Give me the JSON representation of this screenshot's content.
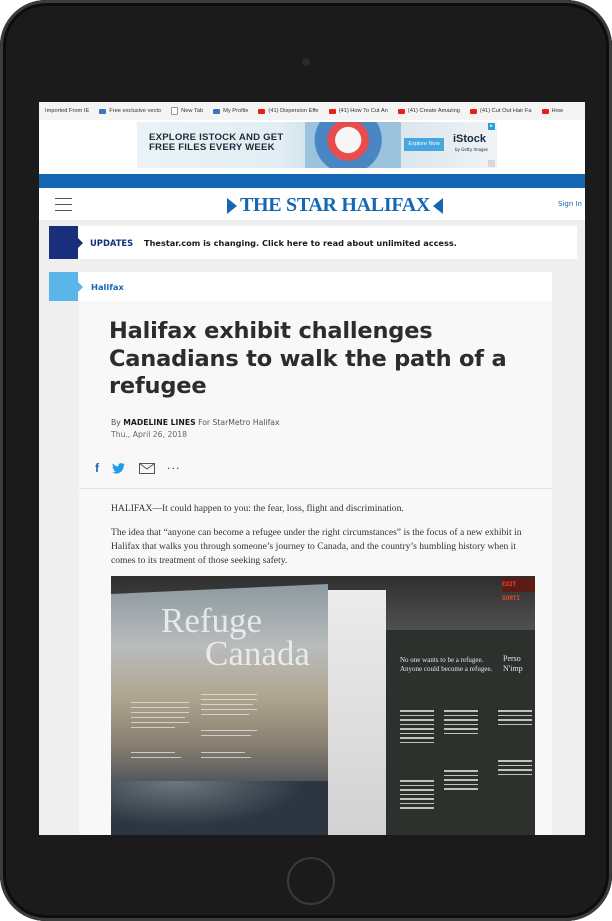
{
  "bookmarks": [
    {
      "label": "Imported From IE",
      "icon": "none"
    },
    {
      "label": "Free exclusive vecto",
      "icon": "image-icon",
      "color": "#3a77c2"
    },
    {
      "label": "New Tab",
      "icon": "page-icon",
      "color": "#ffffff"
    },
    {
      "label": "My Profile",
      "icon": "image-icon",
      "color": "#3a77c2"
    },
    {
      "label": "(41) Dispersion Effe",
      "icon": "youtube-icon",
      "color": "#e62117"
    },
    {
      "label": "(41) How To Cut An",
      "icon": "youtube-icon",
      "color": "#e62117"
    },
    {
      "label": "(41) Create Amazing",
      "icon": "youtube-icon",
      "color": "#e62117"
    },
    {
      "label": "(41) Cut Out Hair Fa",
      "icon": "youtube-icon",
      "color": "#e62117"
    },
    {
      "label": "How",
      "icon": "youtube-icon",
      "color": "#e62117"
    }
  ],
  "ad": {
    "headline_line1": "EXPLORE ISTOCK AND GET",
    "headline_line2": "FREE FILES EVERY WEEK",
    "button": "Explore Now",
    "brand": "iStock",
    "brand_sub": "by Getty Images"
  },
  "header": {
    "logo": "THE STAR HALIFAX",
    "sign_in": "Sign In"
  },
  "updates": {
    "label": "UPDATES",
    "message": "Thestar.com is changing. Click here to read about unlimited access.",
    "close": "×"
  },
  "section": {
    "label": "Halifax"
  },
  "article": {
    "headline": "Halifax exhibit challenges Canadians to walk the path of a refugee",
    "byline_prefix": "By",
    "author": "MADELINE LINES",
    "byline_suffix": "For StarMetro Halifax",
    "date": "Thu., April 26, 2018",
    "share": {
      "facebook": "f",
      "more": "···"
    },
    "paragraphs": [
      "HALIFAX—It could happen to you: the fear, loss, flight and discrimination.",
      "The idea that “anyone can become a refugee under the right circumstances” is the focus of a new exhibit in Halifax that walks you through someone’s journey to Canada, and the country’s humbling history when it comes to its treatment of those seeking safety."
    ]
  },
  "photo": {
    "title_line1": "Refuge",
    "title_line2": "Canada",
    "panel_line1": "No one wants to be a refugee.",
    "panel_line2": "Anyone could become a refugee.",
    "side_line1": "Perso",
    "side_line2": "N'imp",
    "sign": "EXIT SORTI"
  },
  "colors": {
    "brand_blue": "#1467b3",
    "updates_accent": "#1a2f7c",
    "section_accent": "#5ab5e8"
  }
}
